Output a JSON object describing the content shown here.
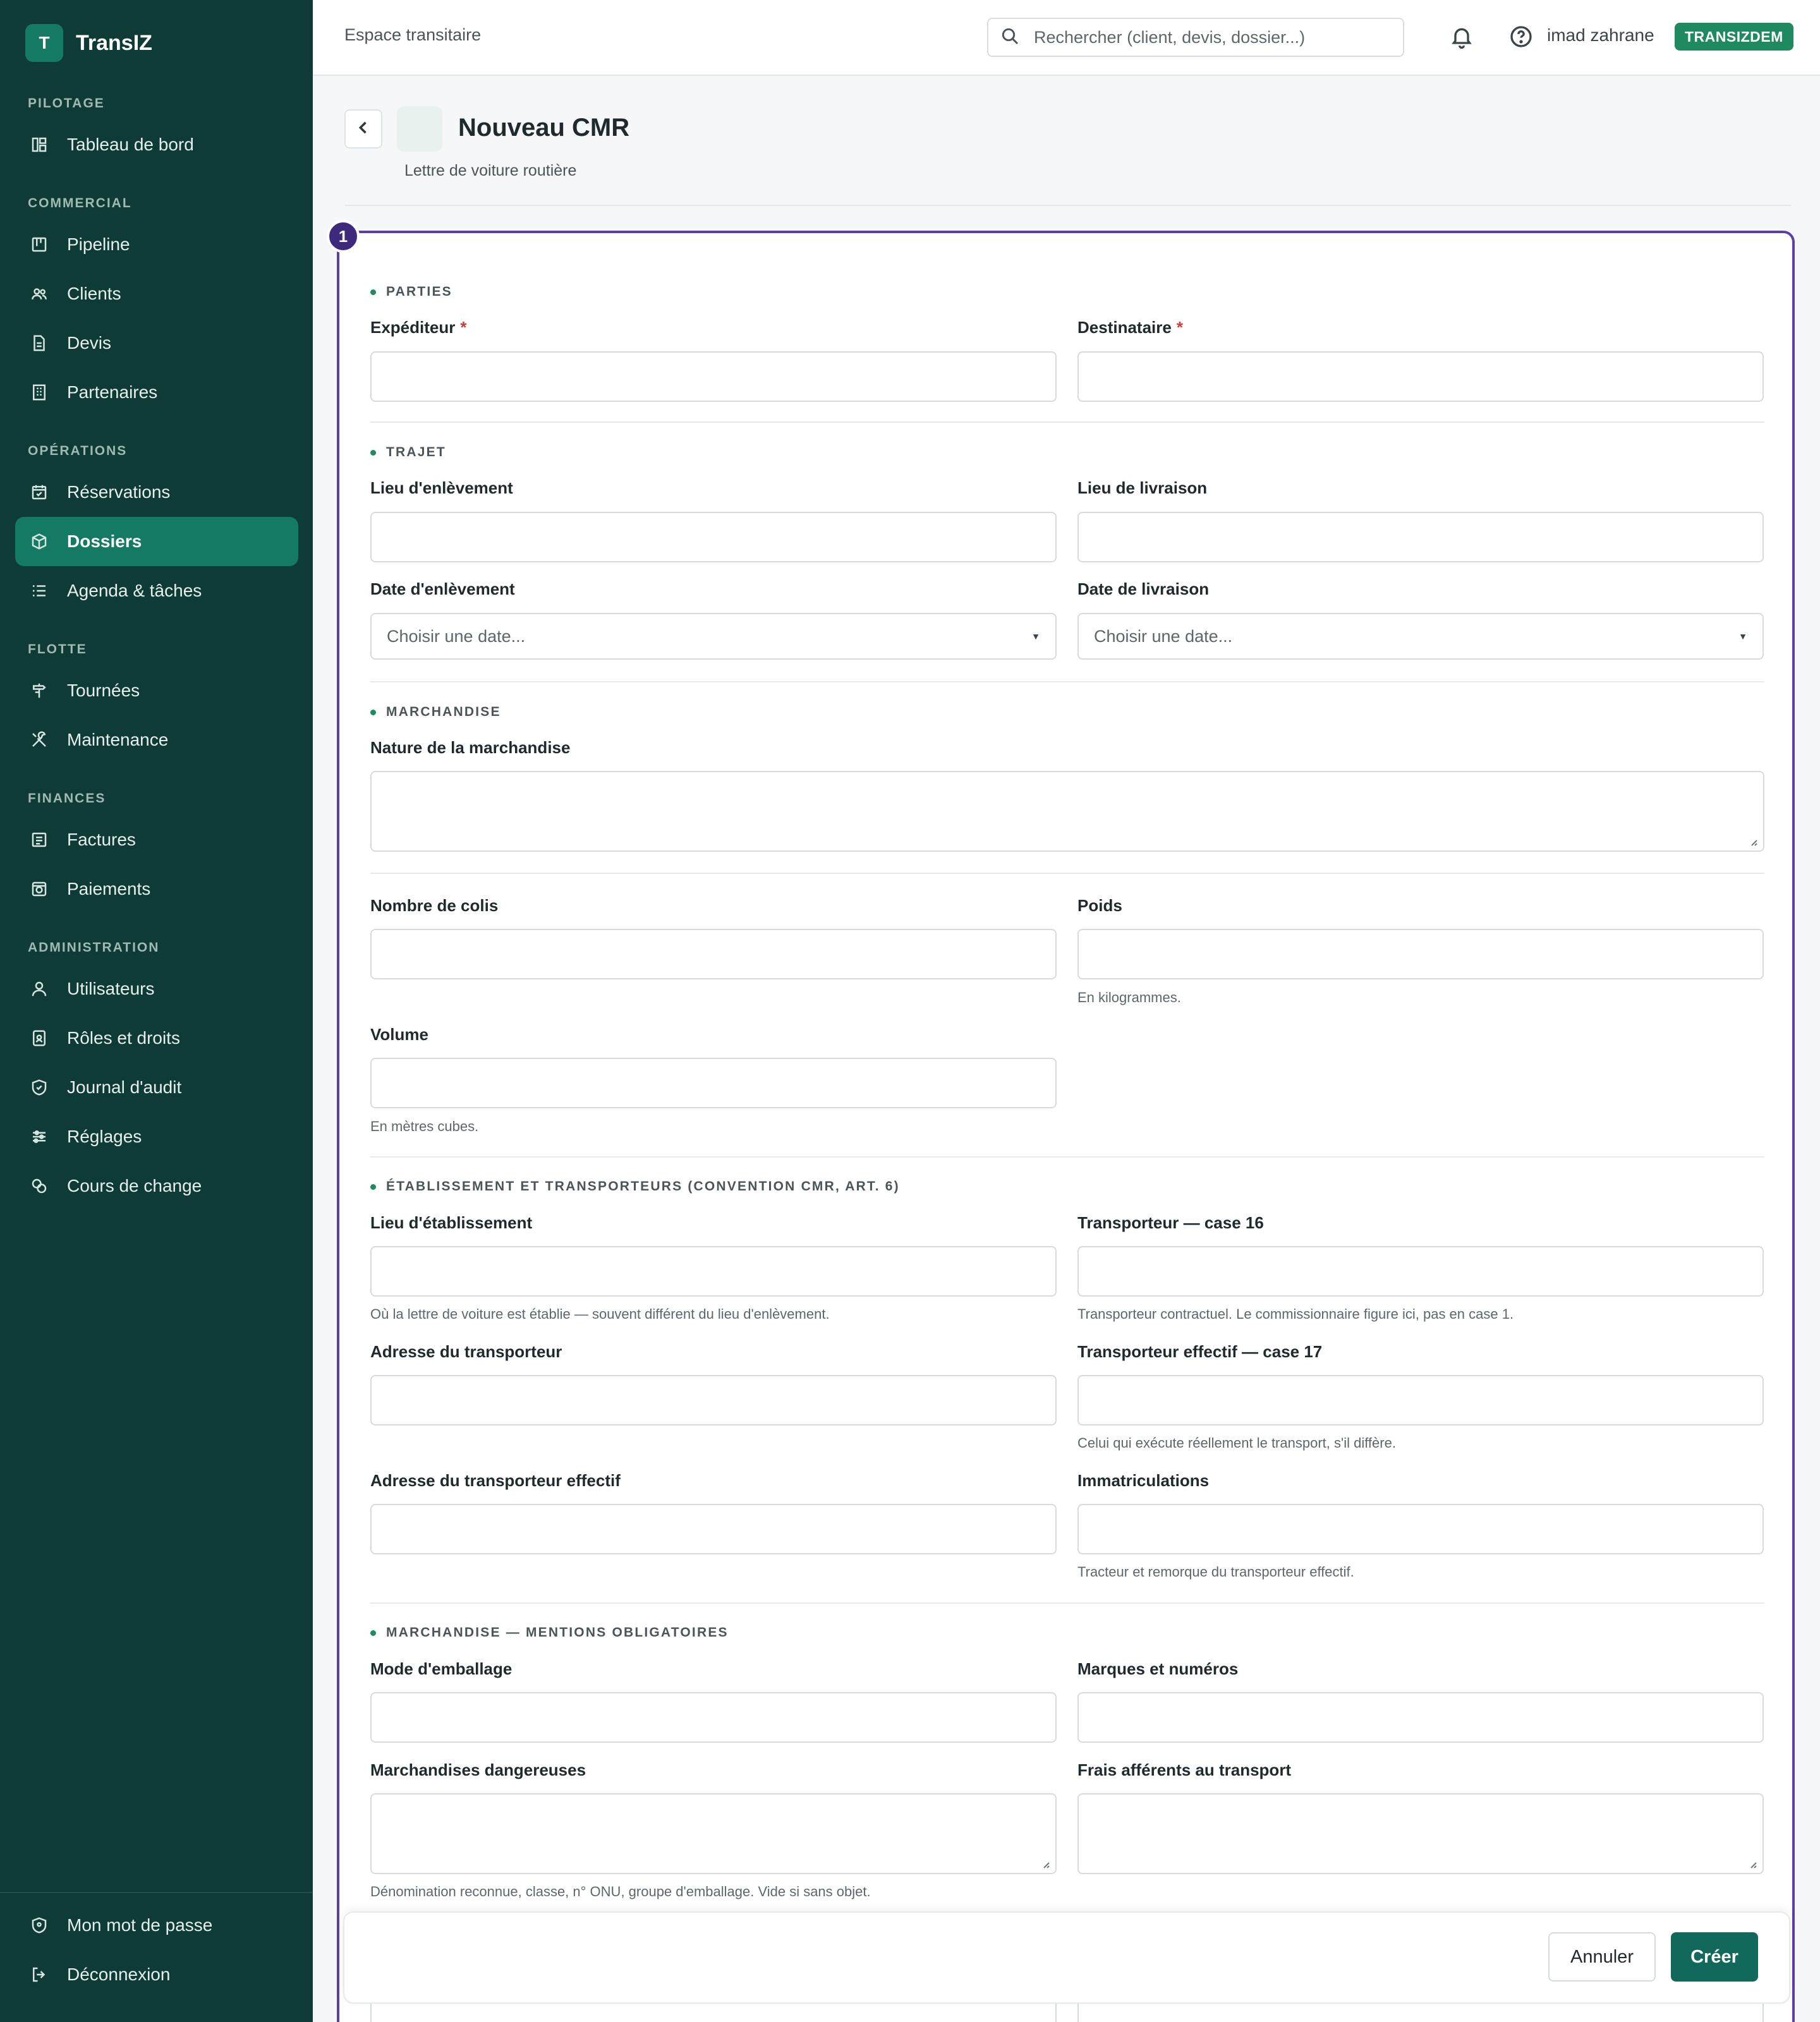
{
  "app": {
    "logo_letter": "T",
    "name": "TransIZ"
  },
  "topbar": {
    "title": "Espace transitaire",
    "search_placeholder": "Rechercher (client, devis, dossier...)",
    "user_name": "imad zahrane",
    "org_badge": "TRANSIZDEM"
  },
  "sidebar": {
    "sections": [
      {
        "label": "PILOTAGE",
        "items": [
          {
            "label": "Tableau de bord",
            "icon": "dashboard-icon"
          }
        ]
      },
      {
        "label": "COMMERCIAL",
        "items": [
          {
            "label": "Pipeline",
            "icon": "kanban-icon"
          },
          {
            "label": "Clients",
            "icon": "users-icon"
          },
          {
            "label": "Devis",
            "icon": "file-icon"
          },
          {
            "label": "Partenaires",
            "icon": "building-icon"
          }
        ]
      },
      {
        "label": "OPÉRATIONS",
        "items": [
          {
            "label": "Réservations",
            "icon": "calendar-check-icon"
          },
          {
            "label": "Dossiers",
            "icon": "box-icon",
            "active": true
          },
          {
            "label": "Agenda & tâches",
            "icon": "list-icon"
          }
        ]
      },
      {
        "label": "FLOTTE",
        "items": [
          {
            "label": "Tournées",
            "icon": "route-icon"
          },
          {
            "label": "Maintenance",
            "icon": "tools-icon"
          }
        ]
      },
      {
        "label": "FINANCES",
        "items": [
          {
            "label": "Factures",
            "icon": "invoice-icon"
          },
          {
            "label": "Paiements",
            "icon": "payment-icon"
          }
        ]
      },
      {
        "label": "ADMINISTRATION",
        "items": [
          {
            "label": "Utilisateurs",
            "icon": "user-icon"
          },
          {
            "label": "Rôles et droits",
            "icon": "badge-icon"
          },
          {
            "label": "Journal d'audit",
            "icon": "shield-check-icon"
          },
          {
            "label": "Réglages",
            "icon": "sliders-icon"
          },
          {
            "label": "Cours de change",
            "icon": "coins-icon"
          }
        ]
      }
    ],
    "bottom": [
      {
        "label": "Mon mot de passe",
        "icon": "shield-icon"
      },
      {
        "label": "Déconnexion",
        "icon": "logout-icon"
      }
    ]
  },
  "page": {
    "title": "Nouveau CMR",
    "subtitle": "Lettre de voiture routière",
    "step": "1"
  },
  "form": {
    "sections": {
      "parties": "PARTIES",
      "trajet": "TRAJET",
      "marchandise": "MARCHANDISE",
      "etablissement": "ÉTABLISSEMENT ET TRANSPORTEURS (CONVENTION CMR, ART. 6)",
      "mentions": "MARCHANDISE — MENTIONS OBLIGATOIRES"
    },
    "fields": {
      "expediteur": "Expéditeur",
      "destinataire": "Destinataire",
      "required_mark": "*",
      "lieu_enlevement": "Lieu d'enlèvement",
      "lieu_livraison": "Lieu de livraison",
      "date_enlevement": "Date d'enlèvement",
      "date_livraison": "Date de livraison",
      "date_placeholder": "Choisir une date...",
      "nature": "Nature de la marchandise",
      "nombre_colis": "Nombre de colis",
      "poids": "Poids",
      "poids_hint": "En kilogrammes.",
      "volume": "Volume",
      "volume_hint": "En mètres cubes.",
      "lieu_etablissement": "Lieu d'établissement",
      "lieu_etablissement_hint": "Où la lettre de voiture est établie — souvent différent du lieu d'enlèvement.",
      "transporteur16": "Transporteur — case 16",
      "transporteur16_hint": "Transporteur contractuel. Le commissionnaire figure ici, pas en case 1.",
      "adresse_transporteur": "Adresse du transporteur",
      "transporteur17": "Transporteur effectif — case 17",
      "transporteur17_hint": "Celui qui exécute réellement le transport, s'il diffère.",
      "adresse_transporteur_effectif": "Adresse du transporteur effectif",
      "immatriculations": "Immatriculations",
      "immatriculations_hint": "Tracteur et remorque du transporteur effectif.",
      "mode_emballage": "Mode d'emballage",
      "marques_numeros": "Marques et numéros",
      "dangereuses": "Marchandises dangereuses",
      "dangereuses_hint": "Dénomination reconnue, classe, n° ONU, groupe d'emballage. Vide si sans objet.",
      "frais": "Frais afférents au transport"
    }
  },
  "actions": {
    "cancel": "Annuler",
    "create": "Créer"
  },
  "colors": {
    "sidebar_bg": "#0e3b35",
    "accent": "#157a64",
    "focus_border": "#5b3ea8",
    "badge_bg": "#1f8a5f"
  }
}
